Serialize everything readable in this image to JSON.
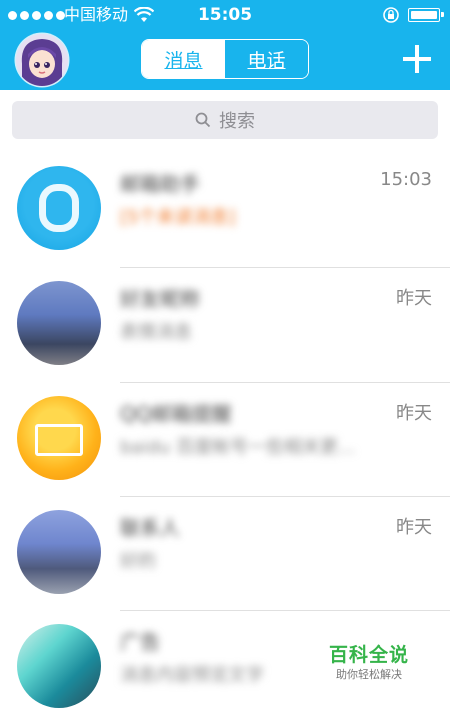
{
  "status_bar": {
    "carrier": "中国移动",
    "time": "15:05"
  },
  "header": {
    "tabs": [
      {
        "label": "消息",
        "active": true
      },
      {
        "label": "电话",
        "active": false
      }
    ],
    "accent_color": "#18b4ed"
  },
  "search": {
    "placeholder": "搜索"
  },
  "conversations": [
    {
      "name": "邮箱助手",
      "preview": "[5个未读消息]",
      "time": "15:03",
      "icon": "mail-assistant-icon"
    },
    {
      "name": "好友昵称",
      "preview": "表情消息",
      "time": "昨天",
      "icon": "photo-avatar"
    },
    {
      "name": "QQ邮箱提醒",
      "preview": "baidu 百度帐号一些相关更...",
      "time": "昨天",
      "icon": "mail-icon"
    },
    {
      "name": "联系人",
      "preview": "好的",
      "time": "昨天",
      "icon": "photo-avatar"
    },
    {
      "name": "广告",
      "preview": "消息内容预览文字",
      "time": "",
      "icon": "photo-avatar"
    }
  ],
  "watermark": {
    "title": "百科全说",
    "subtitle": "助你轻松解决"
  }
}
